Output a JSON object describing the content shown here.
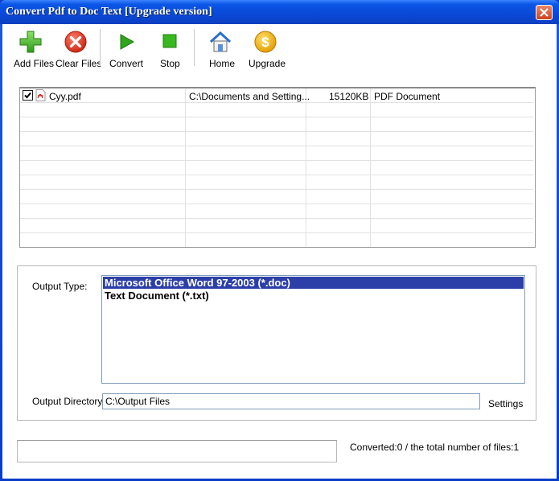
{
  "window": {
    "title": "Convert Pdf to Doc Text [Upgrade version]"
  },
  "toolbar": {
    "add_files": "Add Files",
    "clear_files": "Clear Files",
    "convert": "Convert",
    "stop": "Stop",
    "home": "Home",
    "upgrade": "Upgrade"
  },
  "files": [
    {
      "checked": true,
      "name": "Cyy.pdf",
      "path": "C:\\Documents and Setting...",
      "size": "15120KB",
      "type": "PDF Document"
    }
  ],
  "output": {
    "type_label": "Output Type:",
    "types": [
      "Microsoft Office Word 97-2003 (*.doc)",
      "Text Document (*.txt)"
    ],
    "selected_type": "Microsoft Office Word 97-2003 (*.doc)",
    "dir_label": "Output Directory:",
    "dir_value": "C:\\Output Files",
    "settings_label": "Settings"
  },
  "status": {
    "text": "Converted:0  /  the total number of files:1"
  },
  "colors": {
    "selection": "#2c3fa8",
    "titlebar": "#0a48d6"
  }
}
